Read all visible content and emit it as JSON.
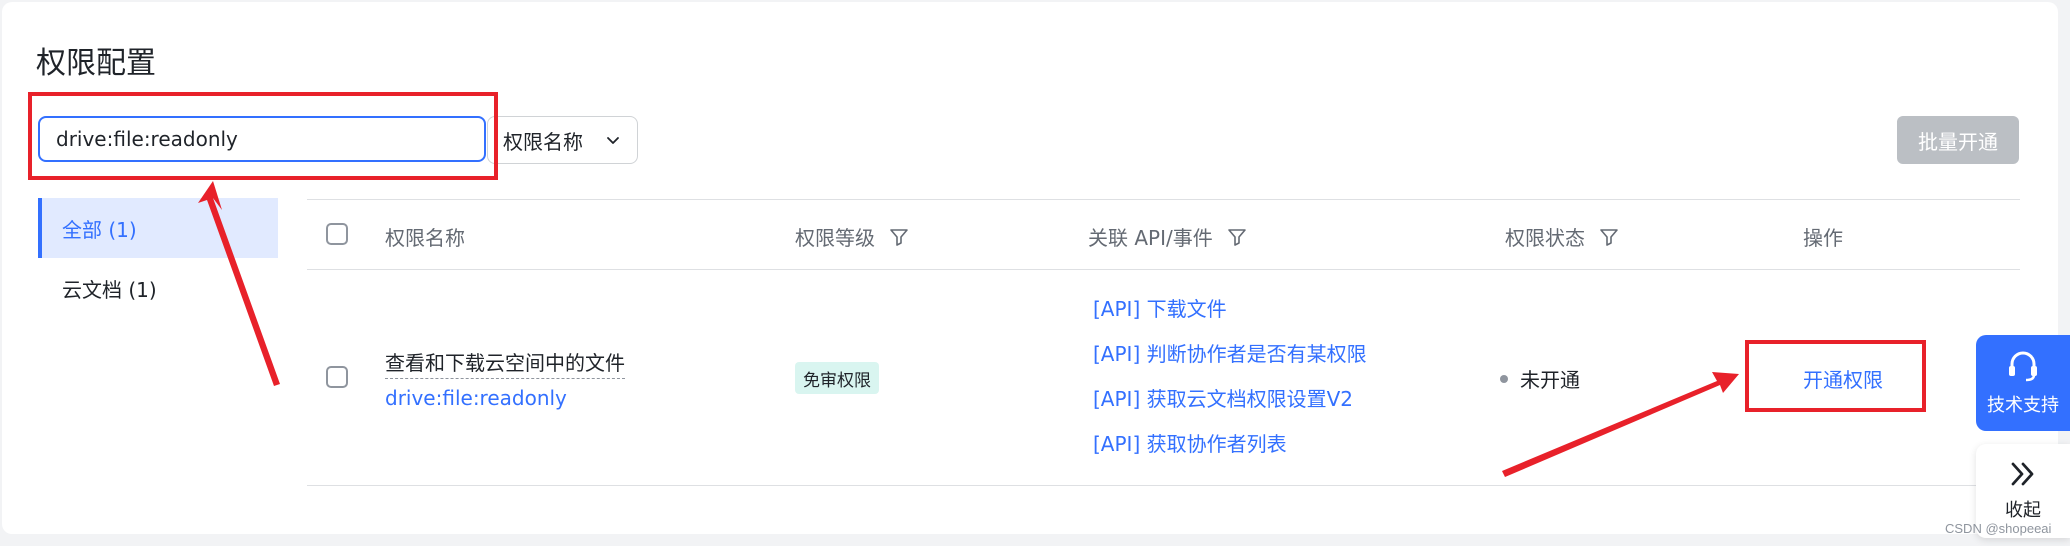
{
  "page_title": "权限配置",
  "search": {
    "value": "drive:file:readonly"
  },
  "filter_select": {
    "selected": "权限名称"
  },
  "batch_button": "批量开通",
  "sidebar": {
    "items": [
      {
        "label": "全部 (1)",
        "active": true
      },
      {
        "label": "云文档 (1)",
        "active": false
      }
    ]
  },
  "table": {
    "headers": {
      "name": "权限名称",
      "level": "权限等级",
      "api": "关联 API/事件",
      "status": "权限状态",
      "action": "操作"
    },
    "rows": [
      {
        "name": "查看和下载云空间中的文件",
        "code": "drive:file:readonly",
        "level": "免审权限",
        "apis": [
          "[API] 下载文件",
          "[API] 判断协作者是否有某权限",
          "[API] 获取云文档权限设置V2",
          "[API] 获取协作者列表"
        ],
        "status": "未开通",
        "action": "开通权限"
      }
    ]
  },
  "float": {
    "support": "技术支持",
    "collapse": "收起"
  },
  "watermark": "CSDN @shopeeai",
  "colors": {
    "accent": "#3370ff",
    "annotation_red": "#e8212a",
    "tag_bg": "#d9f5f0",
    "disabled_button": "#bbbfc4"
  },
  "icons": [
    "chevron-down-icon",
    "filter-icon",
    "headset-icon",
    "double-chevron-right-icon"
  ]
}
